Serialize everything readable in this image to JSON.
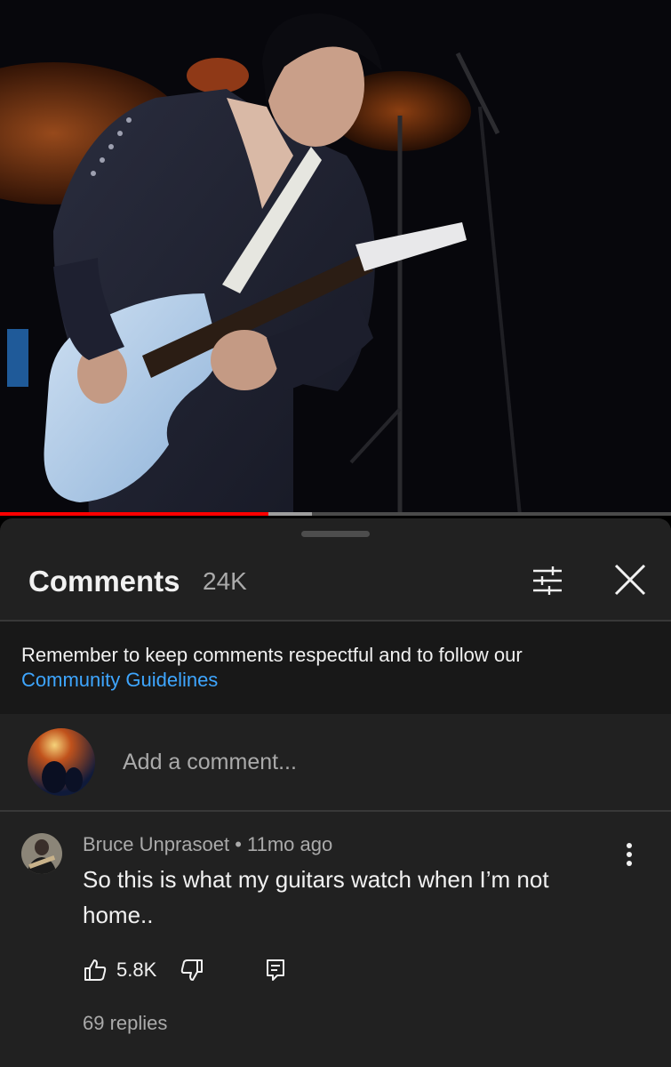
{
  "video": {
    "progress_played": 0.4,
    "progress_buffered": 0.465
  },
  "comments_panel": {
    "title": "Comments",
    "count": "24K",
    "notice_text": "Remember to keep comments respectful and to follow our",
    "notice_link": "Community Guidelines",
    "add_comment_placeholder": "Add a comment...",
    "icons": {
      "filter": "sort-filter-icon",
      "close": "close-icon",
      "more": "more-vert-icon",
      "like": "thumb-up-icon",
      "dislike": "thumb-down-icon",
      "reply": "reply-comment-icon"
    },
    "colors": {
      "accent_link": "#3ea6ff",
      "progress": "#ff0000",
      "sheet_bg": "#212121"
    }
  },
  "comment": {
    "author": "Bruce Unprasoet",
    "time": "11mo ago",
    "meta": "Bruce Unprasoet • 11mo ago",
    "text": "So this is what my guitars watch when I’m not home..",
    "likes": "5.8K",
    "replies": "69 replies"
  }
}
